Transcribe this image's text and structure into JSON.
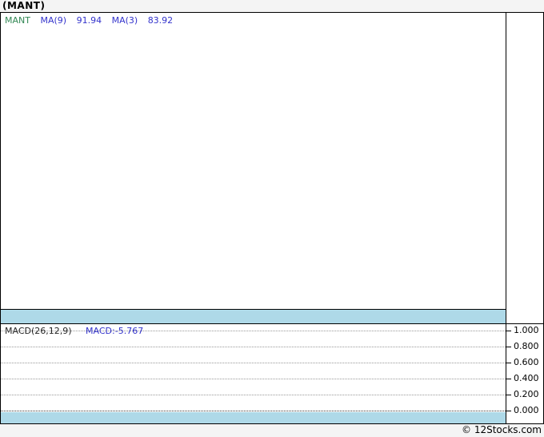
{
  "header": {
    "title": "(MANT)"
  },
  "main_chart": {
    "legend": {
      "symbol": "MANT",
      "ma9_label": "MA(9)",
      "ma9_value": "91.94",
      "ma3_label": "MA(3)",
      "ma3_value": "83.92"
    },
    "colors": {
      "symbol_text": "#338855",
      "ma_text": "#3333cc",
      "separator_band": "#aed9e8",
      "border": "#000000",
      "background": "#ffffff"
    }
  },
  "macd_panel": {
    "label": "MACD(26,12,9)",
    "value_label": "MACD:-5.767",
    "axis_ticks": [
      "1.000",
      "0.800",
      "0.600",
      "0.400",
      "0.200",
      "0.000"
    ]
  },
  "footer": {
    "copyright": "© 12Stocks.com"
  },
  "chart_data": [
    {
      "type": "line",
      "title": "(MANT)",
      "series": [],
      "indicators": {
        "MA(9)": 91.94,
        "MA(3)": 83.92
      },
      "note_visible_content": "price plot area is empty in the screenshot"
    },
    {
      "type": "line",
      "title": "MACD(26,12,9)",
      "ylim": [
        0.0,
        1.0
      ],
      "yticks": [
        1.0,
        0.8,
        0.6,
        0.4,
        0.2,
        0.0
      ],
      "grid": "dotted horizontal",
      "series": [],
      "indicators": {
        "MACD": -5.767
      },
      "note_visible_content": "MACD plot area shows only gridlines, no curve"
    }
  ]
}
